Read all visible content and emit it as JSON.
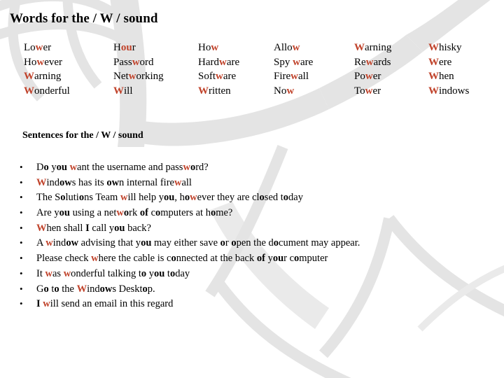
{
  "slide": {
    "title": "Words for the / W / sound",
    "subtitle": "Sentences for the / W / sound",
    "bullet_glyph": "•",
    "colors": {
      "highlight": "#C0422A",
      "text": "#000000",
      "background": "#FFFFFF",
      "watermark": "#E2E2E2"
    }
  },
  "words": {
    "columns": [
      {
        "items": [
          {
            "text": "Lower",
            "parts": [
              {
                "t": "Lo",
                "s": "n"
              },
              {
                "t": "w",
                "s": "h"
              },
              {
                "t": "er",
                "s": "n"
              }
            ]
          },
          {
            "text": "However",
            "parts": [
              {
                "t": "Ho",
                "s": "n"
              },
              {
                "t": "w",
                "s": "h"
              },
              {
                "t": "ever",
                "s": "n"
              }
            ]
          },
          {
            "text": "Warning",
            "parts": [
              {
                "t": "W",
                "s": "h"
              },
              {
                "t": "arning",
                "s": "n"
              }
            ]
          },
          {
            "text": "Wonderful",
            "parts": [
              {
                "t": "W",
                "s": "h"
              },
              {
                "t": "onderful",
                "s": "n"
              }
            ]
          }
        ]
      },
      {
        "items": [
          {
            "text": "Hour",
            "parts": [
              {
                "t": "H",
                "s": "n"
              },
              {
                "t": "ou",
                "s": "h"
              },
              {
                "t": "r",
                "s": "n"
              }
            ]
          },
          {
            "text": "Password",
            "parts": [
              {
                "t": "Pass",
                "s": "n"
              },
              {
                "t": "w",
                "s": "h"
              },
              {
                "t": "ord",
                "s": "n"
              }
            ]
          },
          {
            "text": "Networking",
            "parts": [
              {
                "t": "Net",
                "s": "n"
              },
              {
                "t": "w",
                "s": "h"
              },
              {
                "t": "orking",
                "s": "n"
              }
            ]
          },
          {
            "text": "Will",
            "parts": [
              {
                "t": "W",
                "s": "h"
              },
              {
                "t": "ill",
                "s": "n"
              }
            ]
          }
        ]
      },
      {
        "items": [
          {
            "text": "How",
            "parts": [
              {
                "t": "Ho",
                "s": "n"
              },
              {
                "t": "w",
                "s": "h"
              }
            ]
          },
          {
            "text": "Hardware",
            "parts": [
              {
                "t": "Hard",
                "s": "n"
              },
              {
                "t": "w",
                "s": "h"
              },
              {
                "t": "are",
                "s": "n"
              }
            ]
          },
          {
            "text": "Software",
            "parts": [
              {
                "t": "Soft",
                "s": "n"
              },
              {
                "t": "w",
                "s": "h"
              },
              {
                "t": "are",
                "s": "n"
              }
            ]
          },
          {
            "text": "Written",
            "parts": [
              {
                "t": "W",
                "s": "h"
              },
              {
                "t": "ritten",
                "s": "n"
              }
            ]
          }
        ]
      },
      {
        "items": [
          {
            "text": "Allow",
            "parts": [
              {
                "t": "Allo",
                "s": "n"
              },
              {
                "t": "w",
                "s": "h"
              }
            ]
          },
          {
            "text": "Spy ware",
            "parts": [
              {
                "t": "Spy ",
                "s": "n"
              },
              {
                "t": "w",
                "s": "h"
              },
              {
                "t": "are",
                "s": "n"
              }
            ]
          },
          {
            "text": "Firewall",
            "parts": [
              {
                "t": "Fire",
                "s": "n"
              },
              {
                "t": "w",
                "s": "h"
              },
              {
                "t": "all",
                "s": "n"
              }
            ]
          },
          {
            "text": "Now",
            "parts": [
              {
                "t": "No",
                "s": "n"
              },
              {
                "t": "w",
                "s": "h"
              }
            ]
          }
        ]
      },
      {
        "items": [
          {
            "text": "Warning",
            "parts": [
              {
                "t": "W",
                "s": "h"
              },
              {
                "t": "arning",
                "s": "n"
              }
            ]
          },
          {
            "text": "Rewards",
            "parts": [
              {
                "t": "Re",
                "s": "n"
              },
              {
                "t": "w",
                "s": "h"
              },
              {
                "t": "ards",
                "s": "n"
              }
            ]
          },
          {
            "text": "Power",
            "parts": [
              {
                "t": "Po",
                "s": "n"
              },
              {
                "t": "w",
                "s": "h"
              },
              {
                "t": "er",
                "s": "n"
              }
            ]
          },
          {
            "text": "Tower",
            "parts": [
              {
                "t": "To",
                "s": "n"
              },
              {
                "t": "w",
                "s": "h"
              },
              {
                "t": "er",
                "s": "n"
              }
            ]
          }
        ]
      },
      {
        "items": [
          {
            "text": "Whisky",
            "parts": [
              {
                "t": "W",
                "s": "h"
              },
              {
                "t": "hisky",
                "s": "n"
              }
            ]
          },
          {
            "text": "Were",
            "parts": [
              {
                "t": "W",
                "s": "h"
              },
              {
                "t": "ere",
                "s": "n"
              }
            ]
          },
          {
            "text": "When",
            "parts": [
              {
                "t": "W",
                "s": "h"
              },
              {
                "t": "hen",
                "s": "n"
              }
            ]
          },
          {
            "text": "Windows",
            "parts": [
              {
                "t": "W",
                "s": "h"
              },
              {
                "t": "indows",
                "s": "n"
              }
            ]
          }
        ]
      }
    ]
  },
  "sentences": {
    "items": [
      {
        "text": "Do you want the username and password?",
        "parts": [
          {
            "t": "D",
            "s": "n"
          },
          {
            "t": "o",
            "s": "b"
          },
          {
            "t": " y",
            "s": "n"
          },
          {
            "t": "ou",
            "s": "b"
          },
          {
            "t": " ",
            "s": "n"
          },
          {
            "t": "w",
            "s": "h"
          },
          {
            "t": "ant the username and pass",
            "s": "n"
          },
          {
            "t": "w",
            "s": "h"
          },
          {
            "t": "o",
            "s": "b"
          },
          {
            "t": "rd?",
            "s": "n"
          }
        ]
      },
      {
        "text": "Windows has its own internal firewall",
        "parts": [
          {
            "t": "W",
            "s": "h"
          },
          {
            "t": "ind",
            "s": "n"
          },
          {
            "t": "ow",
            "s": "b"
          },
          {
            "t": "s has its ",
            "s": "n"
          },
          {
            "t": "ow",
            "s": "b"
          },
          {
            "t": "n internal fire",
            "s": "n"
          },
          {
            "t": "w",
            "s": "h"
          },
          {
            "t": "all",
            "s": "n"
          }
        ]
      },
      {
        "text": "The Solutions Team will help you, however they are closed today",
        "parts": [
          {
            "t": "The S",
            "s": "n"
          },
          {
            "t": "o",
            "s": "b"
          },
          {
            "t": "luti",
            "s": "n"
          },
          {
            "t": "o",
            "s": "b"
          },
          {
            "t": "ns Team ",
            "s": "n"
          },
          {
            "t": "w",
            "s": "h"
          },
          {
            "t": "ill help y",
            "s": "n"
          },
          {
            "t": "ou",
            "s": "b"
          },
          {
            "t": ", h",
            "s": "n"
          },
          {
            "t": "o",
            "s": "b"
          },
          {
            "t": "",
            "s": "n"
          },
          {
            "t": "w",
            "s": "h"
          },
          {
            "t": "ever they are cl",
            "s": "n"
          },
          {
            "t": "o",
            "s": "b"
          },
          {
            "t": "sed t",
            "s": "n"
          },
          {
            "t": "o",
            "s": "b"
          },
          {
            "t": "day",
            "s": "n"
          }
        ]
      },
      {
        "text": "Are you using a network of computers at home?",
        "parts": [
          {
            "t": "Are y",
            "s": "n"
          },
          {
            "t": "ou",
            "s": "b"
          },
          {
            "t": " using a net",
            "s": "n"
          },
          {
            "t": "w",
            "s": "h"
          },
          {
            "t": "o",
            "s": "b"
          },
          {
            "t": "rk ",
            "s": "n"
          },
          {
            "t": "of",
            "s": "b"
          },
          {
            "t": " c",
            "s": "n"
          },
          {
            "t": "o",
            "s": "b"
          },
          {
            "t": "mputers at h",
            "s": "n"
          },
          {
            "t": "o",
            "s": "b"
          },
          {
            "t": "me?",
            "s": "n"
          }
        ]
      },
      {
        "text": "When shall I call you back?",
        "parts": [
          {
            "t": "W",
            "s": "h"
          },
          {
            "t": "hen shall ",
            "s": "n"
          },
          {
            "t": "I",
            "s": "b"
          },
          {
            "t": " call y",
            "s": "n"
          },
          {
            "t": "ou",
            "s": "b"
          },
          {
            "t": " back?",
            "s": "n"
          }
        ]
      },
      {
        "text": " A window advising that you may either save or open the document may appear.",
        "parts": [
          {
            "t": " A ",
            "s": "n"
          },
          {
            "t": "w",
            "s": "h"
          },
          {
            "t": "ind",
            "s": "n"
          },
          {
            "t": "ow",
            "s": "b"
          },
          {
            "t": " advising that y",
            "s": "n"
          },
          {
            "t": "ou",
            "s": "b"
          },
          {
            "t": " may either save ",
            "s": "n"
          },
          {
            "t": "o",
            "s": "b"
          },
          {
            "t": "r ",
            "s": "n"
          },
          {
            "t": "o",
            "s": "b"
          },
          {
            "t": "pen the d",
            "s": "n"
          },
          {
            "t": "o",
            "s": "b"
          },
          {
            "t": "cument may appear.",
            "s": "n"
          }
        ]
      },
      {
        "text": "Please check where the cable is connected at the back of your computer",
        "parts": [
          {
            "t": "Please check ",
            "s": "n"
          },
          {
            "t": "w",
            "s": "h"
          },
          {
            "t": "here the cable is c",
            "s": "n"
          },
          {
            "t": "o",
            "s": "b"
          },
          {
            "t": "nnected at the back ",
            "s": "n"
          },
          {
            "t": "of",
            "s": "b"
          },
          {
            "t": " y",
            "s": "n"
          },
          {
            "t": "ou",
            "s": "b"
          },
          {
            "t": "r c",
            "s": "n"
          },
          {
            "t": "o",
            "s": "b"
          },
          {
            "t": "mputer",
            "s": "n"
          }
        ]
      },
      {
        "text": "It was wonderful talking to you today",
        "parts": [
          {
            "t": "It ",
            "s": "n"
          },
          {
            "t": "w",
            "s": "h"
          },
          {
            "t": "as ",
            "s": "n"
          },
          {
            "t": "w",
            "s": "h"
          },
          {
            "t": "onderful talking t",
            "s": "n"
          },
          {
            "t": "o",
            "s": "b"
          },
          {
            "t": " y",
            "s": "n"
          },
          {
            "t": "ou",
            "s": "b"
          },
          {
            "t": " t",
            "s": "n"
          },
          {
            "t": "o",
            "s": "b"
          },
          {
            "t": "day",
            "s": "n"
          }
        ]
      },
      {
        "text": " Go to the Windows Desktop.",
        "parts": [
          {
            "t": " G",
            "s": "n"
          },
          {
            "t": "o",
            "s": "b"
          },
          {
            "t": " t",
            "s": "n"
          },
          {
            "t": "o",
            "s": "b"
          },
          {
            "t": " the ",
            "s": "n"
          },
          {
            "t": "W",
            "s": "h"
          },
          {
            "t": "ind",
            "s": "n"
          },
          {
            "t": "ow",
            "s": "b"
          },
          {
            "t": "s Deskt",
            "s": "n"
          },
          {
            "t": "o",
            "s": "b"
          },
          {
            "t": "p.",
            "s": "n"
          }
        ]
      },
      {
        "text": "I will send an email in this regard",
        "parts": [
          {
            "t": "I",
            "s": "b"
          },
          {
            "t": " ",
            "s": "n"
          },
          {
            "t": "w",
            "s": "h"
          },
          {
            "t": "ill send an email in this regard",
            "s": "n"
          }
        ]
      }
    ]
  }
}
